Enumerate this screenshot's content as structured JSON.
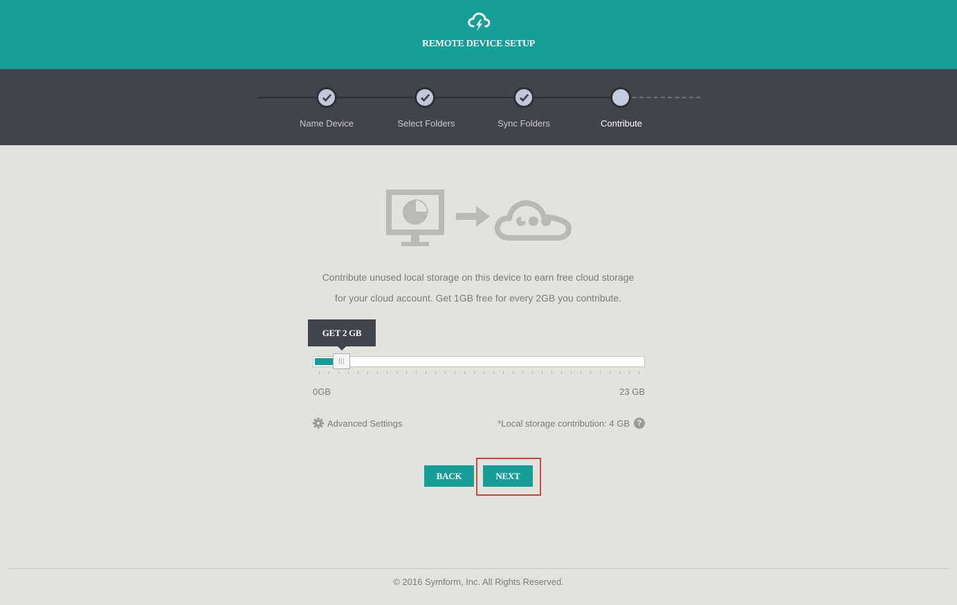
{
  "header": {
    "title": "REMOTE DEVICE SETUP",
    "logo_icon": "cloud-lightning-icon"
  },
  "steps": [
    {
      "label": "Name Device",
      "state": "complete"
    },
    {
      "label": "Select Folders",
      "state": "complete"
    },
    {
      "label": "Sync Folders",
      "state": "complete"
    },
    {
      "label": "Contribute",
      "state": "current"
    }
  ],
  "description": {
    "line1": "Contribute unused local storage on this device to earn free cloud storage",
    "line2": "for your cloud account. Get 1GB free for every 2GB you contribute."
  },
  "slider": {
    "tooltip": "GET 2 GB",
    "min_label": "0GB",
    "max_label": "23 GB",
    "value_gb": 4,
    "max_gb": 23
  },
  "advanced_settings": {
    "label": "Advanced Settings",
    "icon": "gear-icon"
  },
  "contribution": {
    "text": "*Local storage contribution: 4 GB",
    "help_glyph": "?"
  },
  "buttons": {
    "back": "BACK",
    "next": "NEXT"
  },
  "footer": {
    "copyright": "© 2016 Symform, Inc. All Rights Reserved."
  },
  "colors": {
    "accent": "#169e98",
    "step_bar": "#41434d",
    "background": "#e3e3de",
    "highlight": "#d9423a"
  }
}
